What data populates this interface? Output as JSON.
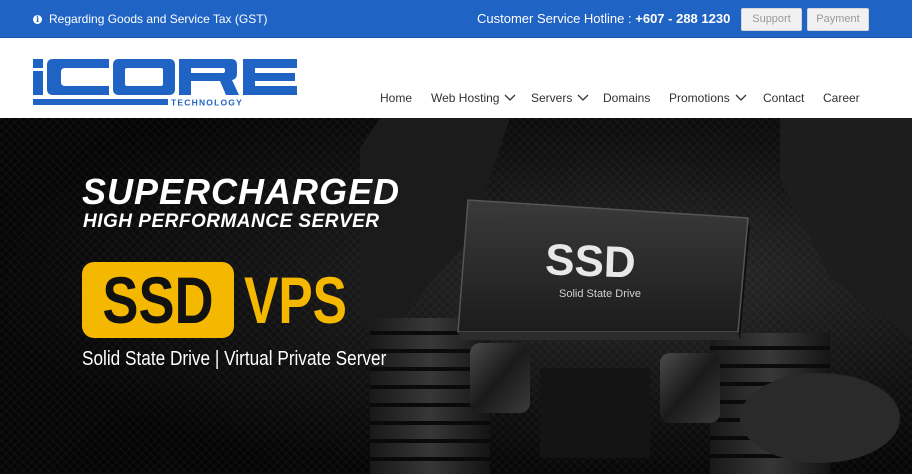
{
  "topbar": {
    "notice": "Regarding Goods and Service Tax (GST)",
    "hotline_label": "Customer Service Hotline :",
    "hotline_number": "+607 - 288 1230",
    "support_label": "Support",
    "payment_label": "Payment",
    "bg_color": "#1f63c4"
  },
  "header": {
    "logo_main": "ICORE",
    "logo_sub": "TECHNOLOGY",
    "logo_color": "#1f63c4"
  },
  "nav": {
    "items": [
      {
        "label": "Home",
        "has_dropdown": false
      },
      {
        "label": "Web Hosting",
        "has_dropdown": true
      },
      {
        "label": "Servers",
        "has_dropdown": true
      },
      {
        "label": "Domains",
        "has_dropdown": false
      },
      {
        "label": "Promotions",
        "has_dropdown": true
      },
      {
        "label": "Contact",
        "has_dropdown": false
      },
      {
        "label": "Career",
        "has_dropdown": false
      }
    ]
  },
  "hero": {
    "title": "SUPERCHARGED",
    "subtitle": "HIGH PERFORMANCE SERVER",
    "ssd": "SSD",
    "vps": "VPS",
    "tagline": "Solid State Drive | Virtual Private Server",
    "drive_label": "SSD",
    "drive_caption": "Solid State Drive",
    "accent_color": "#f5b800"
  }
}
